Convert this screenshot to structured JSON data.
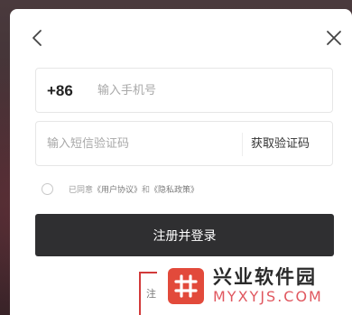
{
  "icons": {
    "back": "chevron-left-icon",
    "close": "close-icon"
  },
  "phone": {
    "country_code": "+86",
    "placeholder": "输入手机号",
    "value": ""
  },
  "code": {
    "placeholder": "输入短信验证码",
    "value": "",
    "get_code_label": "获取验证码"
  },
  "agreement": {
    "prefix": "已同意",
    "user_agreement": "《用户协议》",
    "conjunction": "和",
    "privacy_policy": "《隐私政策》",
    "checked": false
  },
  "submit_label": "注册并登录",
  "bottom_link_text": "注",
  "watermark": {
    "title": "兴业软件园",
    "subtitle": "MYXYJS.COM"
  },
  "colors": {
    "button_bg": "#2f2f31",
    "watermark_red": "#e24a3b",
    "highlight_box": "#d23a3a"
  }
}
